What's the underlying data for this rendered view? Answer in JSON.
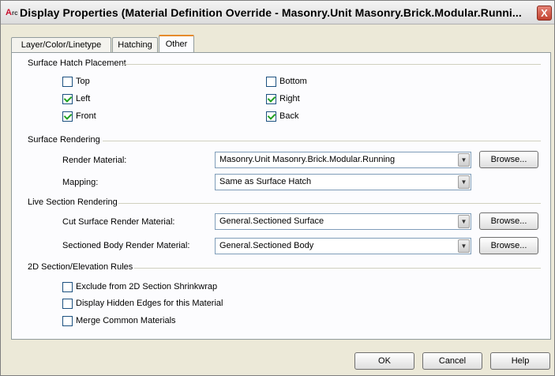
{
  "window": {
    "title": "Display Properties (Material Definition Override - Masonry.Unit Masonry.Brick.Modular.Runni...",
    "close_label": "X"
  },
  "tabs": [
    {
      "label": "Layer/Color/Linetype",
      "active": false
    },
    {
      "label": "Hatching",
      "active": false
    },
    {
      "label": "Other",
      "active": true
    }
  ],
  "surface_hatch_placement": {
    "title": "Surface Hatch Placement",
    "top": {
      "label": "Top",
      "checked": false
    },
    "bottom": {
      "label": "Bottom",
      "checked": false
    },
    "left": {
      "label": "Left",
      "checked": true
    },
    "right": {
      "label": "Right",
      "checked": true
    },
    "front": {
      "label": "Front",
      "checked": true
    },
    "back": {
      "label": "Back",
      "checked": true
    }
  },
  "surface_rendering": {
    "title": "Surface Rendering",
    "render_material_label": "Render Material:",
    "render_material_value": "Masonry.Unit Masonry.Brick.Modular.Running",
    "mapping_label": "Mapping:",
    "mapping_value": "Same as Surface Hatch",
    "browse_label": "Browse..."
  },
  "live_section_rendering": {
    "title": "Live Section Rendering",
    "cut_surface_label": "Cut Surface Render Material:",
    "cut_surface_value": "General.Sectioned Surface",
    "sectioned_body_label": "Sectioned Body Render Material:",
    "sectioned_body_value": "General.Sectioned Body",
    "browse_label": "Browse..."
  },
  "section_elevation_rules": {
    "title": "2D Section/Elevation Rules",
    "exclude": {
      "label": "Exclude from 2D Section Shrinkwrap",
      "checked": false
    },
    "hidden_edges": {
      "label": "Display Hidden Edges for this Material",
      "checked": false
    },
    "merge": {
      "label": "Merge Common Materials",
      "checked": false
    }
  },
  "footer": {
    "ok_label": "OK",
    "cancel_label": "Cancel",
    "help_label": "Help"
  },
  "icons": {
    "app": "autocad-architecture-icon",
    "close": "close-icon",
    "dropdown": "chevron-down-icon"
  },
  "colors": {
    "dialog_bg": "#ece9d8",
    "active_tab_accent": "#e68b2c",
    "checkmark": "#21a121",
    "close_button": "#c2412f"
  }
}
